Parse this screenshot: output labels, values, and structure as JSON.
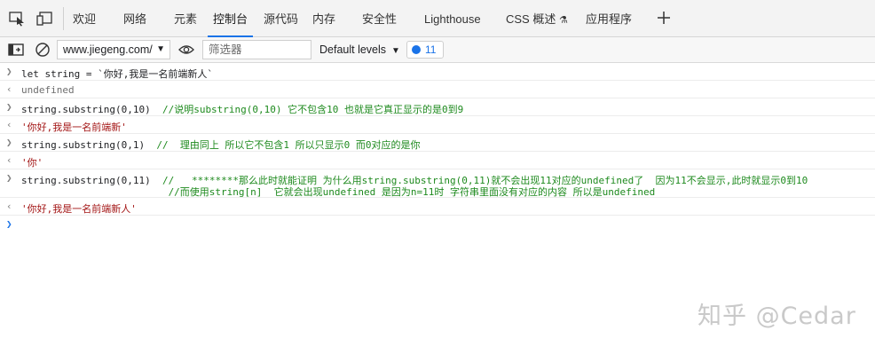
{
  "tabs": [
    {
      "label": "欢迎"
    },
    {
      "label": "网络"
    },
    {
      "label": "元素"
    },
    {
      "label": "控制台"
    },
    {
      "label": "源代码"
    },
    {
      "label": "内存"
    },
    {
      "label": "安全性"
    },
    {
      "label": "Lighthouse"
    },
    {
      "label": "CSS 概述"
    },
    {
      "label": "应用程序"
    }
  ],
  "toolbar": {
    "context": "www.jiegeng.com/",
    "filter_placeholder": "筛选器",
    "levels": "Default levels",
    "message_count": "11"
  },
  "console": {
    "in1": "let string = `你好,我是一名前端新人`",
    "out1": "undefined",
    "in2_code": "string.substring(0,10)",
    "in2_comment": "  //说明substring(0,10) 它不包含10 也就是它真正显示的是0到9",
    "out2": "'你好,我是一名前端新'",
    "in3_code": "string.substring(0,1)",
    "in3_comment": "  //  理由同上 所以它不包含1 所以只显示0 而0对应的是你",
    "out3": "'你'",
    "in4_code": "string.substring(0,11)",
    "in4_comment1": "  //   ********那么此时就能证明 为什么用string.substring(0,11)就不会出现11对应的undefined了  因为11不会显示,此时就显示0到10",
    "in4_comment2": "                         //而使用string[n]  它就会出现undefined 是因为n=11时 字符串里面没有对应的内容 所以是undefined",
    "out4": "'你好,我是一名前端新人'"
  },
  "watermark": "知乎 @Cedar"
}
